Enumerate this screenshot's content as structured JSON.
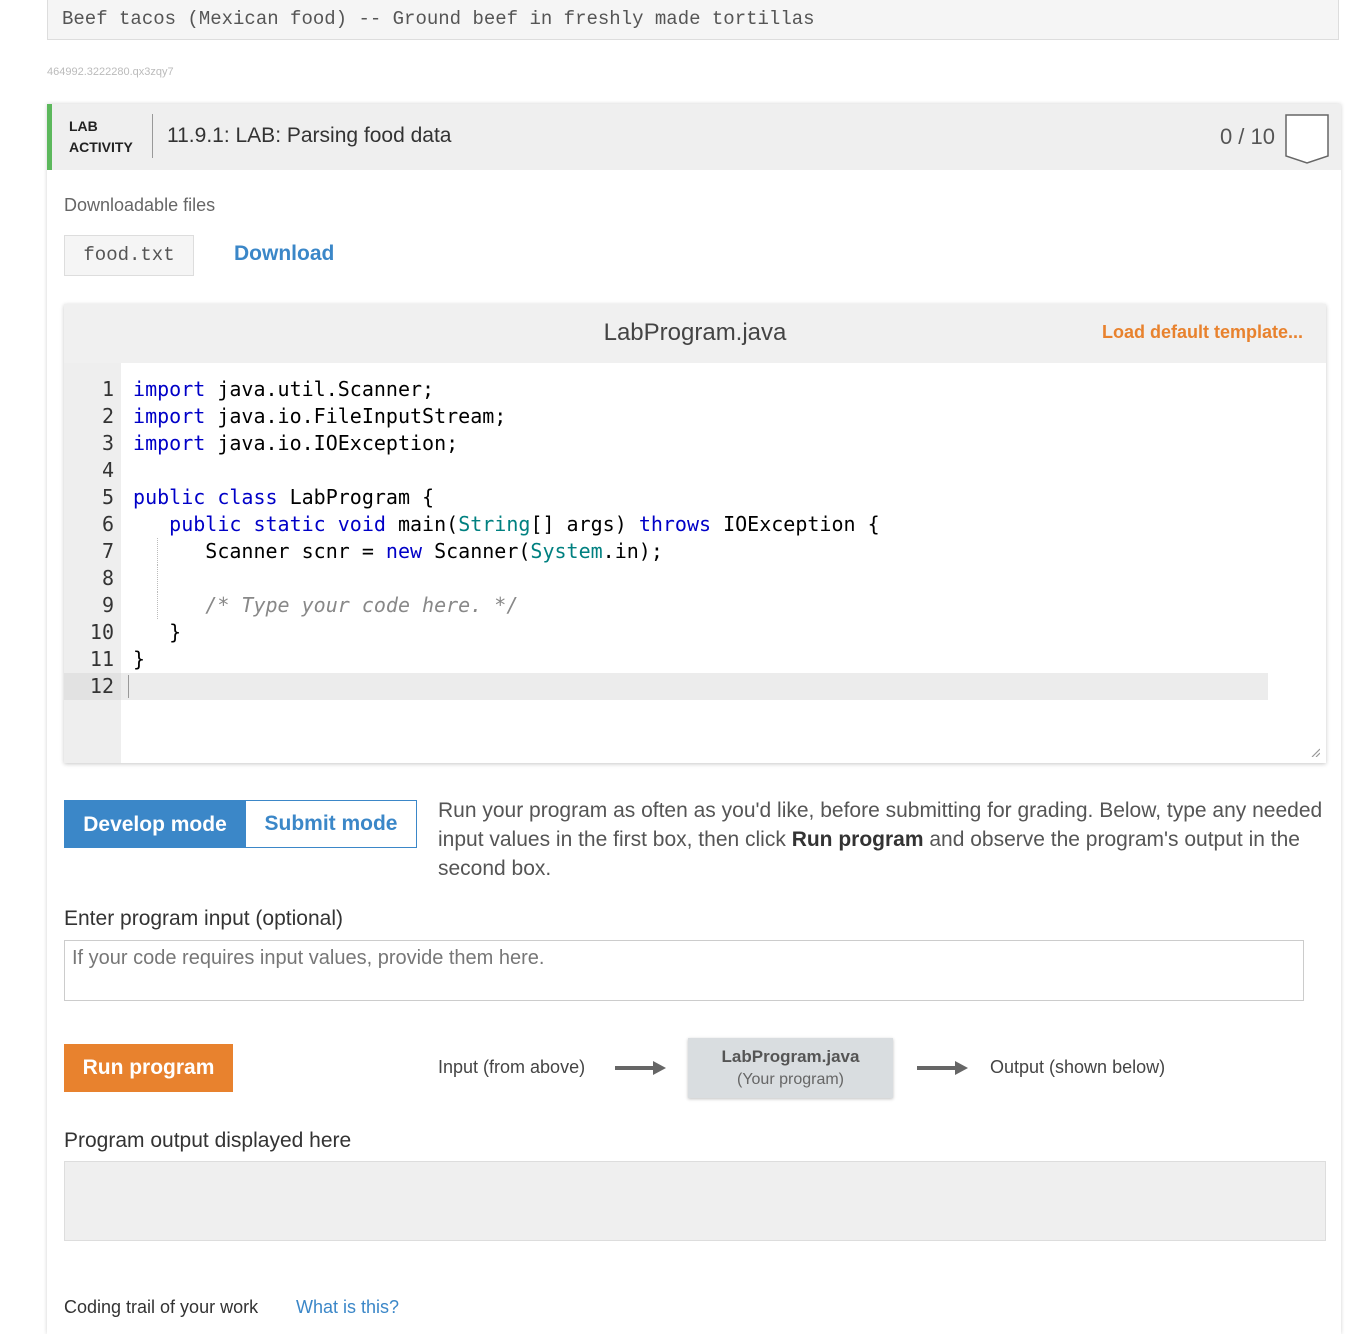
{
  "top_code": "Beef tacos (Mexican food) -- Ground beef in freshly made tortillas",
  "ref_id": "464992.3222280.qx3zqy7",
  "lab": {
    "badge_line1": "LAB",
    "badge_line2": "ACTIVITY",
    "title": "11.9.1: LAB: Parsing food data",
    "score": "0 / 10",
    "accent_color": "#5cb85c"
  },
  "downloads": {
    "label": "Downloadable files",
    "file_name": "food.txt",
    "download_label": "Download"
  },
  "editor": {
    "file_name": "LabProgram.java",
    "load_template_label": "Load default template...",
    "active_line": 12,
    "line_numbers": [
      "1",
      "2",
      "3",
      "4",
      "5",
      "6",
      "7",
      "8",
      "9",
      "10",
      "11",
      "12"
    ],
    "lines": [
      "import java.util.Scanner;",
      "import java.io.FileInputStream;",
      "import java.io.IOException;",
      "",
      "public class LabProgram {",
      "   public static void main(String[] args) throws IOException {",
      "      Scanner scnr = new Scanner(System.in);",
      "",
      "      /* Type your code here. */",
      "   }",
      "}",
      ""
    ]
  },
  "modes": {
    "develop_label": "Develop mode",
    "submit_label": "Submit mode",
    "selected": "Develop mode",
    "desc_part1": "Run your program as often as you'd like, before submitting for grading. Below, type any needed input values in the first box, then click ",
    "desc_bold": "Run program",
    "desc_part2": " and observe the program's output in the second box."
  },
  "input": {
    "label": "Enter program input (optional)",
    "placeholder": "If your code requires input values, provide them here.",
    "value": ""
  },
  "run": {
    "button_label": "Run program",
    "flow_input": "Input (from above)",
    "flow_program_title": "LabProgram.java",
    "flow_program_sub": "(Your program)",
    "flow_output": "Output (shown below)"
  },
  "output": {
    "label": "Program output displayed here",
    "value": ""
  },
  "trail": {
    "label": "Coding trail of your work",
    "link": "What is this?"
  },
  "colors": {
    "primary": "#3b87c8",
    "accent_orange": "#e8822e",
    "keyword": "#0000c7",
    "type": "#008080"
  }
}
